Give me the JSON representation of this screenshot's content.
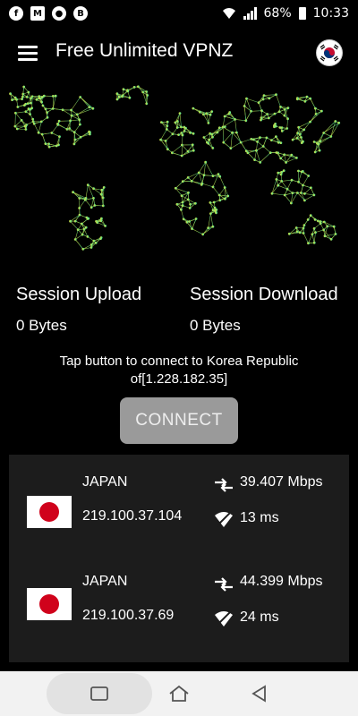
{
  "status_bar": {
    "battery": "68%",
    "time": "10:33",
    "icons_left": [
      "facebook-icon",
      "mail-icon",
      "circle-icon",
      "b-icon"
    ],
    "icons_right": [
      "wifi-icon",
      "volte-icon",
      "signal-icon",
      "battery-icon"
    ]
  },
  "header": {
    "title": "Free Unlimited VPNZ",
    "menu_icon": "hamburger-menu-icon",
    "country_flag": "korea-flag-icon"
  },
  "session": {
    "upload_label": "Session Upload",
    "upload_value": "0 Bytes",
    "download_label": "Session Download",
    "download_value": "0 Bytes"
  },
  "connect": {
    "tap_text": "Tap button to connect to Korea Republic of[1.228.182.35]",
    "button_label": "CONNECT"
  },
  "servers": [
    {
      "country": "JAPAN",
      "ip": "219.100.37.104",
      "speed": "39.407 Mbps",
      "ping": "13 ms"
    },
    {
      "country": "JAPAN",
      "ip": "219.100.37.69",
      "speed": "44.399 Mbps",
      "ping": "24 ms"
    }
  ],
  "colors": {
    "background": "#000000",
    "button": "#9a9a9a",
    "list_bg": "#1c1c1c",
    "map_yellow": "#d6e04a",
    "map_green": "#3fe8a0",
    "japan_red": "#d0021b"
  }
}
